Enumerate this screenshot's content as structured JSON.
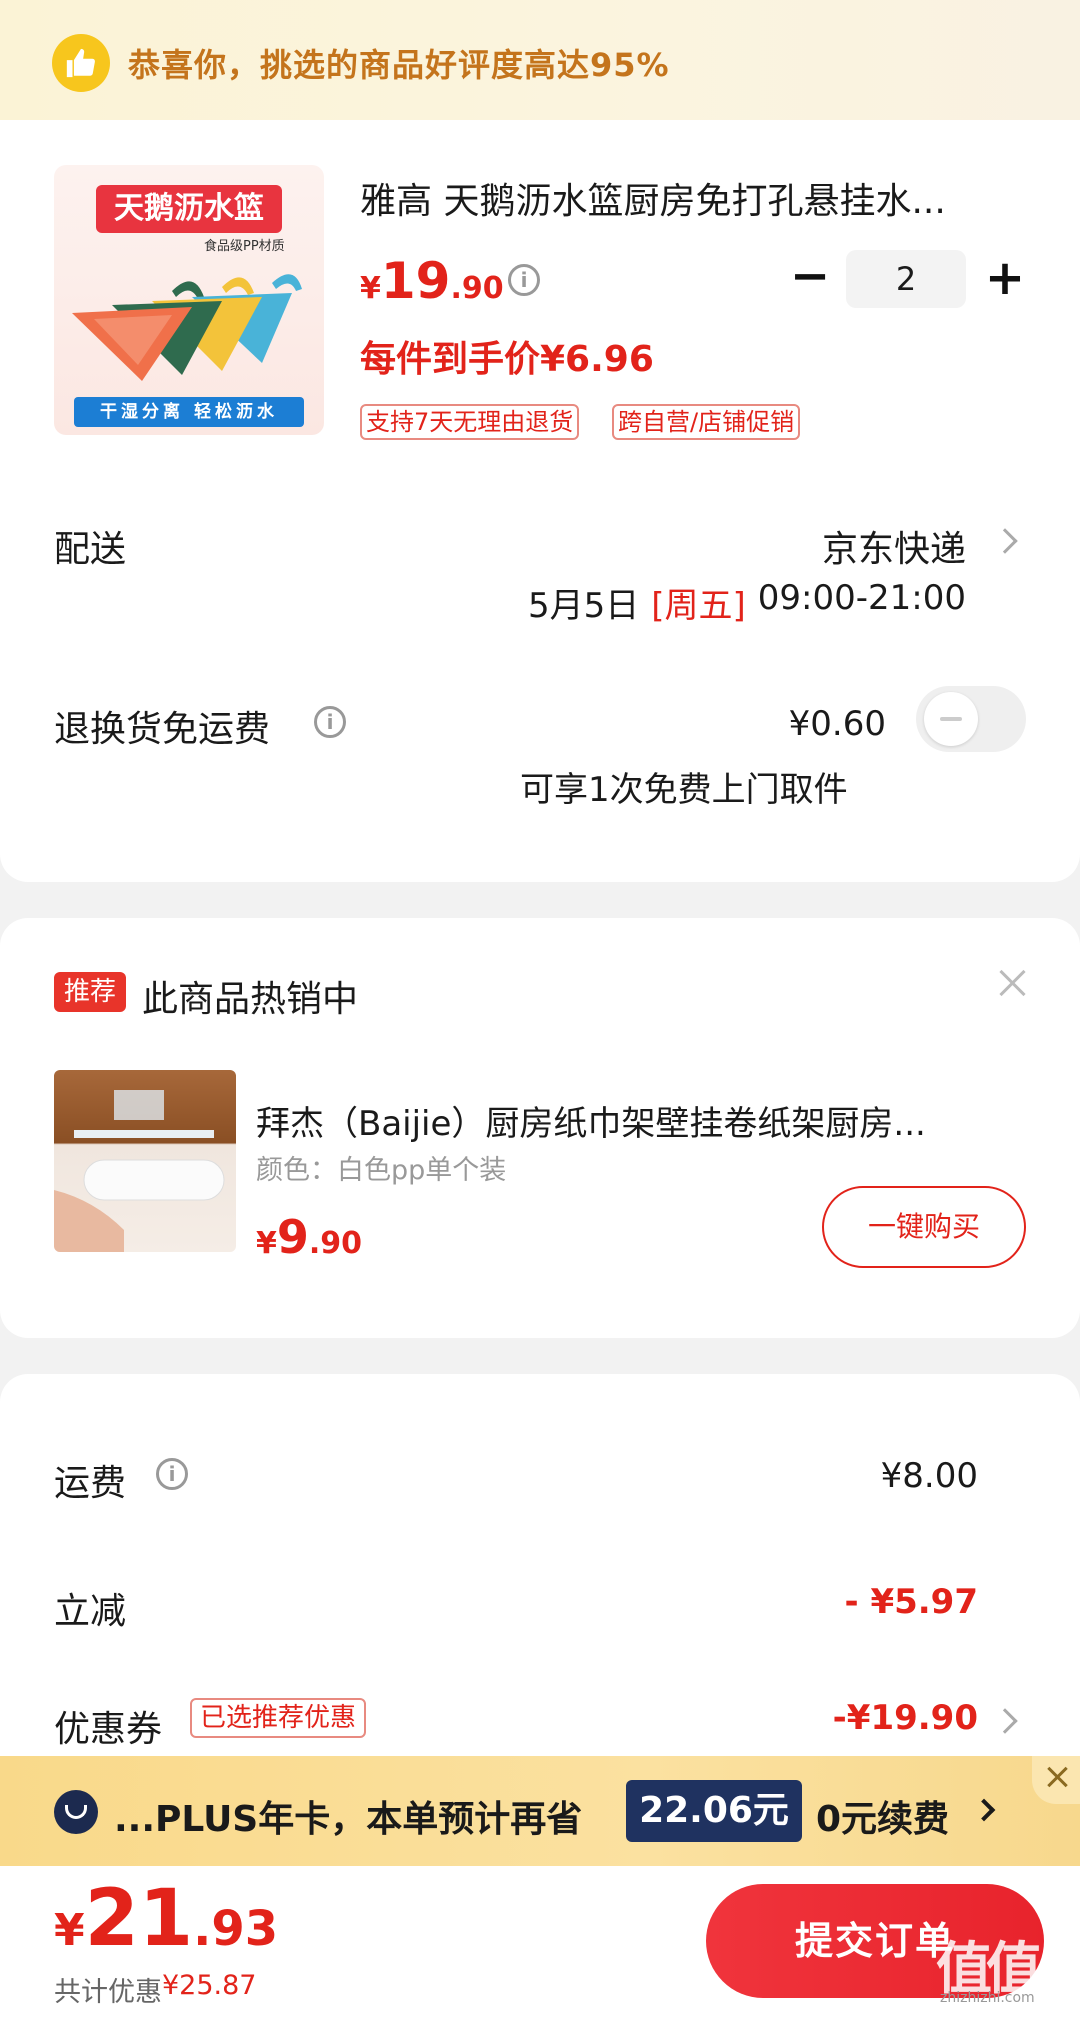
{
  "banner": {
    "text": "恭喜你，挑选的商品好评度高达95%"
  },
  "product": {
    "title": "雅高 天鹅沥水篮厨房免打孔悬挂水...",
    "image_title": "天鹅沥水篮",
    "image_sub": "食品级PP材质",
    "image_bottom": "干湿分离 轻松沥水",
    "price_currency": "¥",
    "price_int": "19",
    "price_dec": ".90",
    "quantity": "2",
    "unit_price": "每件到手价¥6.96",
    "tags": [
      "支持7天无理由退货",
      "跨自营/店铺促销"
    ]
  },
  "shipping": {
    "label": "配送",
    "carrier": "京东快递",
    "date": "5月5日",
    "weekday": "[周五]",
    "time": "09:00-21:00"
  },
  "return_insurance": {
    "label": "退换货免运费",
    "price": "¥0.60",
    "desc": "可享1次免费上门取件",
    "enabled": false
  },
  "recommend": {
    "badge": "推荐",
    "title": "此商品热销中",
    "item_name": "拜杰（Baijie）厨房纸巾架壁挂卷纸架厨房...",
    "item_spec": "颜色：白色pp单个装",
    "price_currency": "¥",
    "price_int": "9",
    "price_dec": ".90",
    "buy_label": "一键购买"
  },
  "summary": {
    "freight_label": "运费",
    "freight_value": "¥8.00",
    "discount_label": "立减",
    "discount_value": "- ¥5.97",
    "coupon_label": "优惠券",
    "coupon_tag": "已选推荐优惠",
    "coupon_value": "-¥19.90"
  },
  "plus": {
    "text": "...PLUS年卡，本单预计再省",
    "amount": "22.06元",
    "renew": "0元续费"
  },
  "footer": {
    "total_currency": "¥",
    "total_int": "21",
    "total_dec": ".93",
    "saved_label": "共计优惠",
    "saved_amount": "¥25.87",
    "submit_label": "提交订单"
  },
  "watermark": {
    "text": "值值值",
    "sub": "zhizhizhi.com"
  },
  "colors": {
    "accent": "#e2231a",
    "banner_text": "#c4741c",
    "plus_dark": "#1f3260"
  }
}
